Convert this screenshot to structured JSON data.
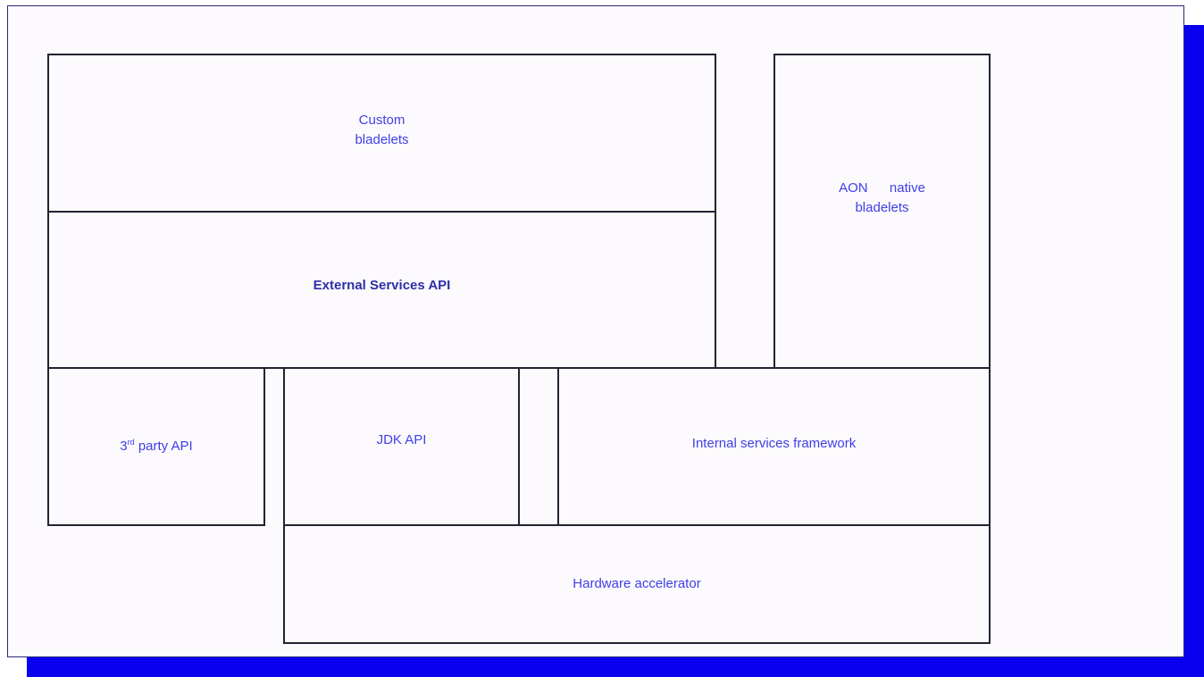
{
  "diagram": {
    "custom_bladelets": {
      "line1": "Custom",
      "line2": "bladelets"
    },
    "aon_native_bladelets": {
      "line1": "AON  native",
      "line2": "bladelets"
    },
    "external_services_api": "External Services API",
    "third_party_api": {
      "prefix": "3",
      "sup": "rd",
      "suffix": " party API"
    },
    "jdk_api": "JDK API",
    "internal_services_framework": "Internal services framework",
    "hardware_accelerator": "Hardware accelerator"
  },
  "colors": {
    "shadow": "#0a00f0",
    "panel": "#fcfafd",
    "border": "#222233",
    "text": "#3f3fe8",
    "bold_text": "#2f2fa8"
  }
}
